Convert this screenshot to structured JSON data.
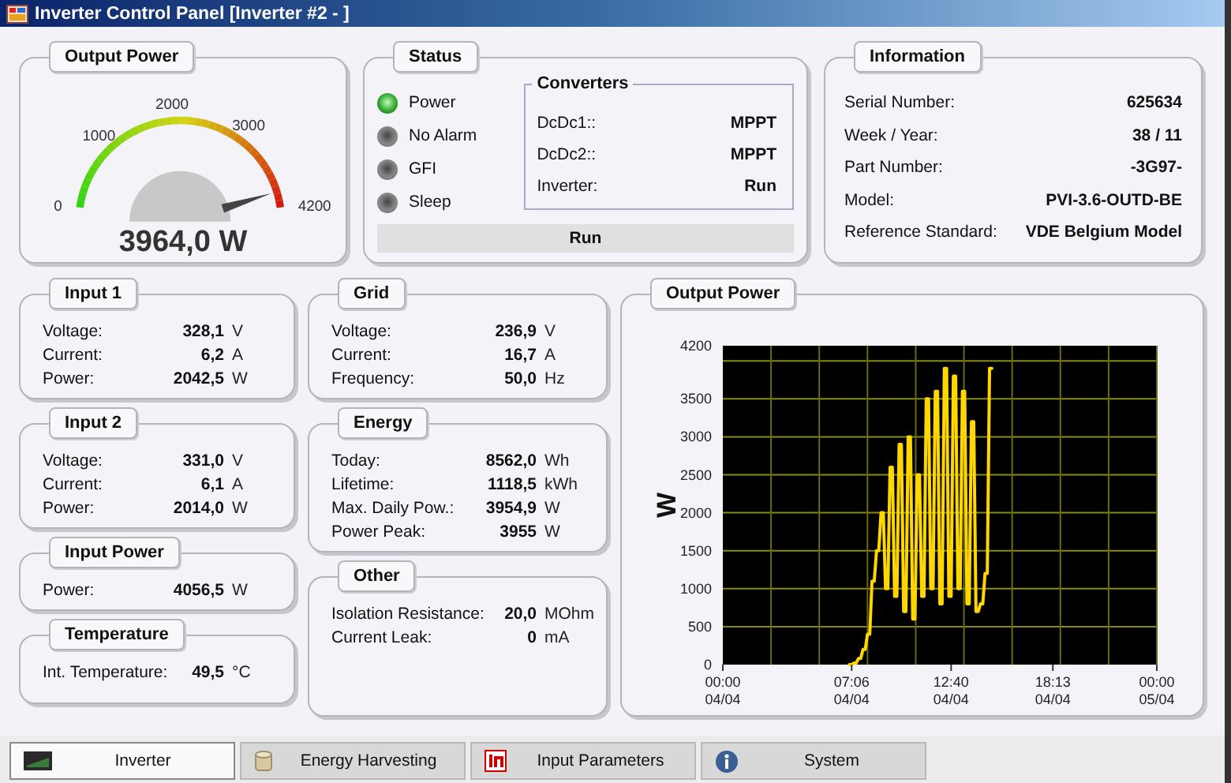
{
  "window": {
    "title": "Inverter Control Panel [Inverter #2 - ]"
  },
  "output_power_gauge": {
    "title": "Output Power",
    "scale_labels": [
      "0",
      "1000",
      "2000",
      "3000",
      "4200"
    ],
    "reading": "3964,0 W"
  },
  "status": {
    "title": "Status",
    "indicators": [
      {
        "label": "Power",
        "on": true
      },
      {
        "label": "No Alarm",
        "on": false
      },
      {
        "label": "GFI",
        "on": false
      },
      {
        "label": "Sleep",
        "on": false
      }
    ],
    "converters": {
      "title": "Converters",
      "rows": [
        {
          "label": "DcDc1::",
          "value": "MPPT"
        },
        {
          "label": "DcDc2::",
          "value": "MPPT"
        },
        {
          "label": "Inverter:",
          "value": "Run"
        }
      ]
    },
    "state": "Run"
  },
  "information": {
    "title": "Information",
    "rows": [
      {
        "label": "Serial Number:",
        "value": "625634"
      },
      {
        "label": "Week / Year:",
        "value": "38 / 11"
      },
      {
        "label": "Part Number:",
        "value": "-3G97-"
      },
      {
        "label": "Model:",
        "value": "PVI-3.6-OUTD-BE"
      },
      {
        "label": "Reference Standard:",
        "value": "VDE Belgium Model"
      }
    ]
  },
  "left_panels": [
    {
      "title": "Input 1",
      "rows": [
        {
          "label": "Voltage:",
          "value": "328,1",
          "unit": "V"
        },
        {
          "label": "Current:",
          "value": "6,2",
          "unit": "A"
        },
        {
          "label": "Power:",
          "value": "2042,5",
          "unit": "W"
        }
      ]
    },
    {
      "title": "Input 2",
      "rows": [
        {
          "label": "Voltage:",
          "value": "331,0",
          "unit": "V"
        },
        {
          "label": "Current:",
          "value": "6,1",
          "unit": "A"
        },
        {
          "label": "Power:",
          "value": "2014,0",
          "unit": "W"
        }
      ]
    },
    {
      "title": "Input Power",
      "rows": [
        {
          "label": "Power:",
          "value": "4056,5",
          "unit": "W"
        }
      ]
    },
    {
      "title": "Temperature",
      "rows": [
        {
          "label": "Int. Temperature:",
          "value": "49,5",
          "unit": "°C"
        }
      ]
    }
  ],
  "middle_panels": [
    {
      "title": "Grid",
      "rows": [
        {
          "label": "Voltage:",
          "value": "236,9",
          "unit": "V"
        },
        {
          "label": "Current:",
          "value": "16,7",
          "unit": "A"
        },
        {
          "label": "Frequency:",
          "value": "50,0",
          "unit": "Hz"
        }
      ]
    },
    {
      "title": "Energy",
      "rows": [
        {
          "label": "Today:",
          "value": "8562,0",
          "unit": "Wh"
        },
        {
          "label": "Lifetime:",
          "value": "1118,5",
          "unit": "kWh"
        },
        {
          "label": "Max. Daily Pow.:",
          "value": "3954,9",
          "unit": "W"
        },
        {
          "label": "Power Peak:",
          "value": "3955",
          "unit": "W"
        }
      ]
    },
    {
      "title": "Other",
      "rows": [
        {
          "label": "Isolation Resistance:",
          "value": "20,0",
          "unit": "MOhm"
        },
        {
          "label": "Current Leak:",
          "value": "0",
          "unit": "mA"
        }
      ]
    }
  ],
  "chart_panel": {
    "title": "Output Power",
    "chart_data": {
      "type": "line",
      "ylabel": "W",
      "grid": true,
      "categories": [
        "00:00\n04/04",
        null,
        null,
        null,
        null,
        null,
        null,
        null,
        null,
        null,
        null,
        null,
        null,
        null,
        null,
        null,
        null,
        null,
        null,
        null,
        null,
        null,
        null,
        null,
        null,
        null,
        null,
        null,
        null,
        null,
        null,
        null,
        null,
        null,
        null,
        null,
        null,
        null,
        null,
        null,
        null,
        null,
        null,
        null,
        null,
        null,
        null,
        null,
        null,
        null,
        null,
        null,
        null,
        null,
        null,
        null,
        null,
        "07:06\n04/04",
        null,
        null,
        null,
        null,
        null,
        null,
        null,
        null,
        null,
        null,
        null,
        null,
        null,
        null,
        null,
        null,
        null,
        null,
        null,
        null,
        null,
        null,
        null,
        null,
        null,
        null,
        null,
        null,
        null,
        null,
        null,
        null,
        null,
        null,
        null,
        null,
        null,
        null,
        null,
        null,
        null,
        null,
        null,
        "12:40\n04/04",
        null,
        null,
        null,
        null,
        null,
        null,
        null,
        null,
        null,
        null,
        null,
        null,
        null,
        null,
        null,
        null,
        null,
        null,
        null,
        null,
        null,
        null,
        null,
        null,
        null,
        null,
        null,
        null,
        null,
        null,
        null,
        null,
        null,
        null,
        null,
        null,
        null,
        null,
        null,
        null,
        null,
        null,
        null,
        null,
        "18:13\n04/04",
        null,
        null,
        null,
        null,
        null,
        null,
        null,
        null,
        null,
        null,
        null,
        null,
        null,
        null,
        null,
        null,
        null,
        null,
        null,
        null,
        null,
        null,
        null,
        null,
        null,
        null,
        null,
        null,
        null,
        null,
        null,
        null,
        null,
        null,
        null,
        null,
        null,
        null,
        null,
        null,
        null,
        null,
        null,
        null,
        null,
        "00:00\n05/04"
      ],
      "series": [
        {
          "color": "#ffd700",
          "values": [
            null,
            null,
            null,
            null,
            null,
            null,
            null,
            null,
            null,
            null,
            null,
            null,
            null,
            null,
            null,
            null,
            null,
            null,
            null,
            null,
            null,
            null,
            null,
            null,
            null,
            null,
            null,
            null,
            null,
            null,
            null,
            null,
            null,
            null,
            null,
            null,
            null,
            null,
            null,
            null,
            null,
            null,
            null,
            null,
            null,
            null,
            null,
            null,
            null,
            null,
            null,
            null,
            null,
            null,
            null,
            null,
            0,
            0,
            20,
            20,
            80,
            80,
            200,
            200,
            400,
            400,
            1100,
            1100,
            1500,
            1500,
            2000,
            2000,
            1000,
            1000,
            2600,
            2600,
            900,
            900,
            2900,
            2900,
            700,
            700,
            3000,
            3000,
            600,
            600,
            2500,
            2500,
            900,
            900,
            3500,
            3500,
            1000,
            1000,
            3600,
            3600,
            800,
            800,
            3900,
            3900,
            900,
            900,
            3800,
            3800,
            1000,
            1000,
            3600,
            3600,
            800,
            800,
            3200,
            3200,
            700,
            700,
            800,
            800,
            1200,
            1200,
            3900,
            3900,
            null,
            null,
            null,
            null,
            null,
            null,
            null,
            null,
            null,
            null,
            null,
            null,
            null,
            null,
            null,
            null,
            null,
            null,
            null,
            null,
            null,
            null,
            null,
            null,
            null,
            null,
            null,
            null,
            null,
            null,
            null,
            null,
            null,
            null,
            null,
            null,
            null,
            null,
            null,
            null,
            null,
            null,
            null,
            null,
            null,
            null,
            null,
            null,
            null,
            null,
            null,
            null,
            null,
            null,
            null,
            null,
            null,
            null,
            null,
            null,
            null,
            null,
            null,
            null,
            null,
            null,
            null,
            null,
            null,
            null,
            null,
            null,
            null
          ]
        }
      ],
      "ylim": [
        0,
        4200
      ],
      "yticks": [
        0,
        500,
        1000,
        1500,
        2000,
        2500,
        3000,
        3500,
        4200
      ]
    }
  },
  "tabs": [
    {
      "label": "Inverter",
      "kind": "inverter",
      "selected": true
    },
    {
      "label": "Energy Harvesting",
      "kind": "energy",
      "selected": false
    },
    {
      "label": "Input Parameters",
      "kind": "input",
      "selected": false
    },
    {
      "label": "System",
      "kind": "info",
      "selected": false
    }
  ]
}
